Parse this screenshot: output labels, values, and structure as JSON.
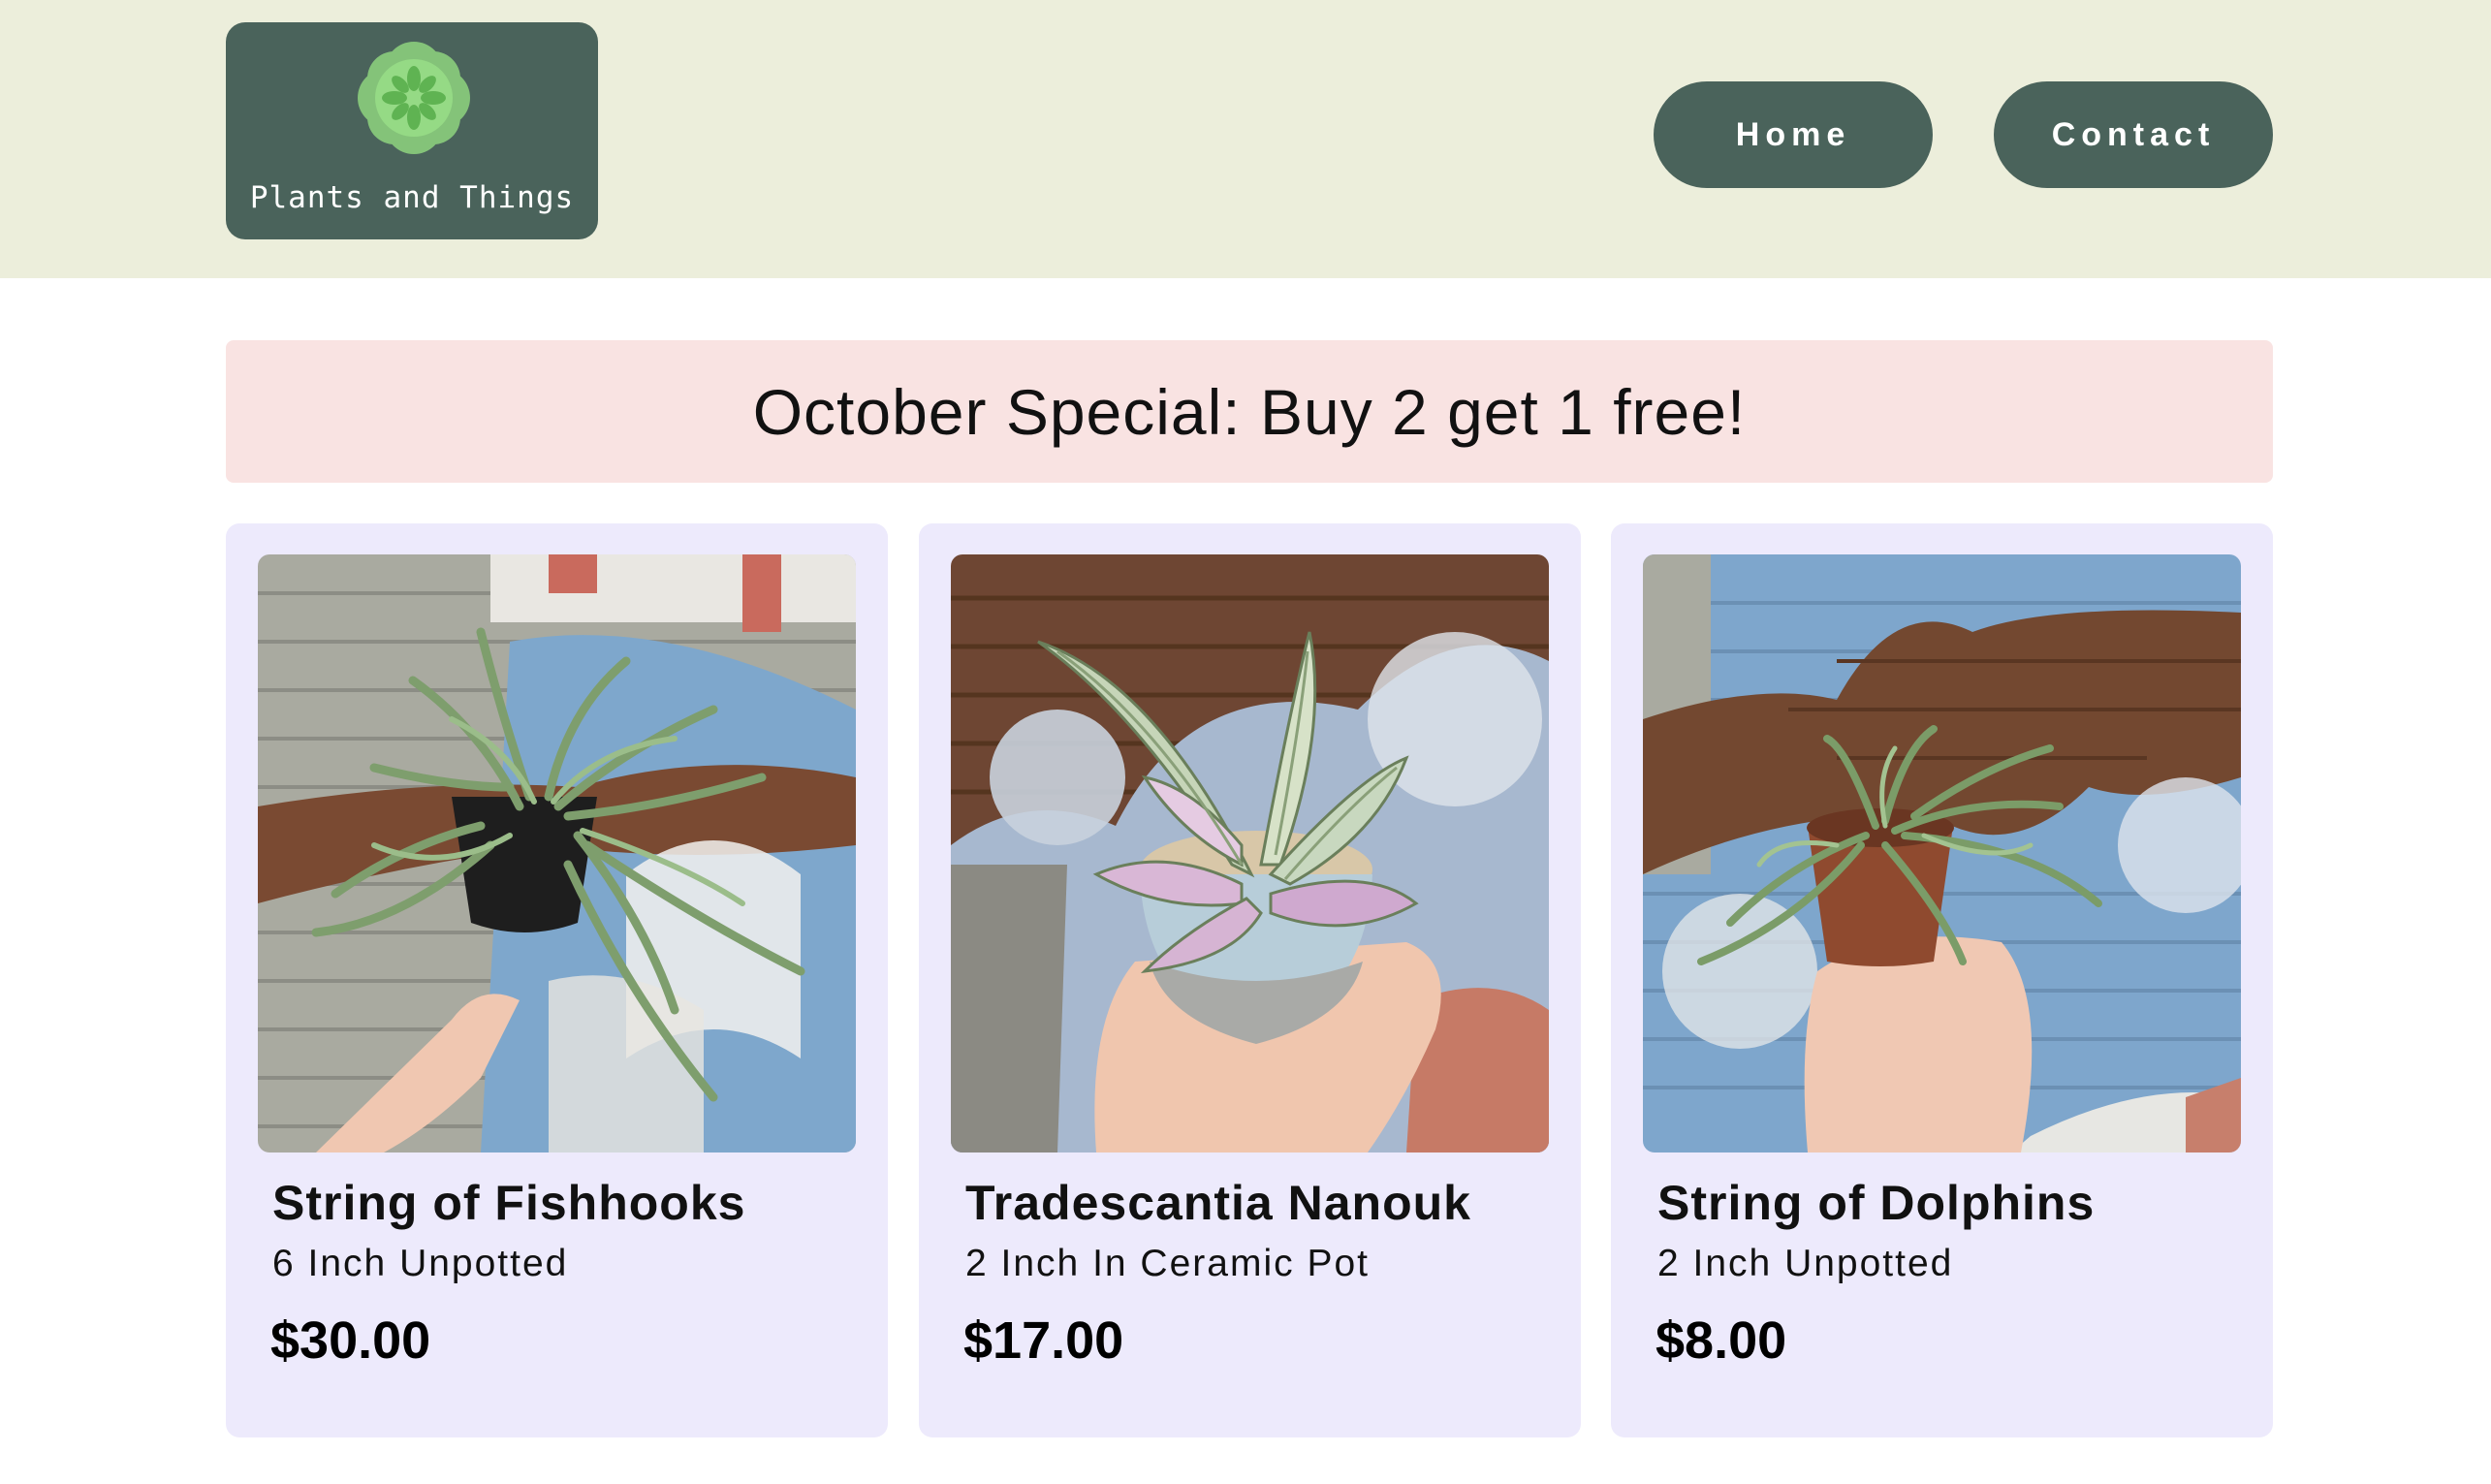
{
  "header": {
    "logo_text": "Plants and Things",
    "nav": {
      "home_label": "Home",
      "contact_label": "Contact"
    }
  },
  "banner": {
    "text": "October Special: Buy 2 get 1 free!"
  },
  "products": [
    {
      "name": "String of Fishhooks",
      "size": "6 Inch Unpotted",
      "price": "$30.00",
      "image_icon": "plant-photo"
    },
    {
      "name": "Tradescantia Nanouk",
      "size": "2 Inch In Ceramic Pot",
      "price": "$17.00",
      "image_icon": "plant-photo"
    },
    {
      "name": "String of Dolphins",
      "size": "2 Inch Unpotted",
      "price": "$8.00",
      "image_icon": "plant-photo"
    }
  ],
  "colors": {
    "header_bg": "#eceedb",
    "accent": "#4a635b",
    "banner_bg": "#f9e3e2",
    "card_bg": "#edeafc",
    "logo_flower": "#8fd47f"
  }
}
